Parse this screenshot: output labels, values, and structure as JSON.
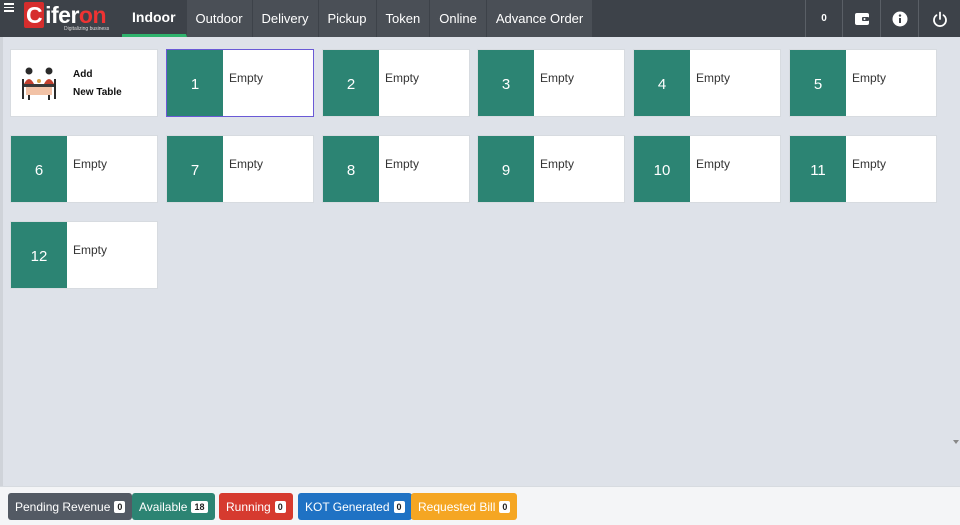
{
  "app": {
    "logo_letter": "C",
    "logo_middle": "ifer",
    "logo_end": "on",
    "tagline": "Digitalizing business"
  },
  "tabs": [
    {
      "label": "Indoor",
      "active": true
    },
    {
      "label": "Outdoor"
    },
    {
      "label": "Delivery"
    },
    {
      "label": "Pickup"
    },
    {
      "label": "Token"
    },
    {
      "label": "Online"
    },
    {
      "label": "Advance Order"
    }
  ],
  "toolbar": {
    "count": "0",
    "icons": [
      "wallet-icon",
      "info-icon",
      "power-icon"
    ]
  },
  "add_table": {
    "line1": "Add",
    "line2": "New Table"
  },
  "tables": [
    {
      "number": "1",
      "status": "Empty",
      "selected": true
    },
    {
      "number": "2",
      "status": "Empty"
    },
    {
      "number": "3",
      "status": "Empty"
    },
    {
      "number": "4",
      "status": "Empty"
    },
    {
      "number": "5",
      "status": "Empty"
    },
    {
      "number": "6",
      "status": "Empty"
    },
    {
      "number": "7",
      "status": "Empty"
    },
    {
      "number": "8",
      "status": "Empty"
    },
    {
      "number": "9",
      "status": "Empty"
    },
    {
      "number": "10",
      "status": "Empty"
    },
    {
      "number": "11",
      "status": "Empty"
    },
    {
      "number": "12",
      "status": "Empty"
    }
  ],
  "legend": [
    {
      "label": "Pending Revenue",
      "count": "0",
      "color": "#535a64"
    },
    {
      "label": "Available",
      "count": "18",
      "color": "#2c8473"
    },
    {
      "label": "Running",
      "count": "0",
      "color": "#d63a2f"
    },
    {
      "label": "KOT Generated",
      "count": "0",
      "color": "#1f72c4"
    },
    {
      "label": "Requested Bill",
      "count": "0",
      "color": "#f5a623"
    }
  ],
  "colors": {
    "topbar": "#3d4249",
    "table_number_bg": "#2c8473",
    "active_tab_underline": "#2fb36d",
    "selected_border": "#6a5ad6"
  }
}
